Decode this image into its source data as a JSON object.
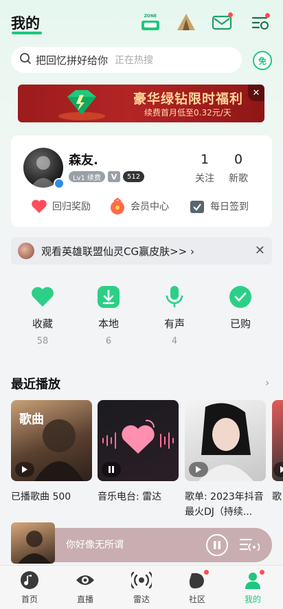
{
  "header": {
    "title": "我的",
    "zone_icon_text": "MUSIC ZONE",
    "icons": [
      "music-zone-icon",
      "tent-icon",
      "mail-icon",
      "menu-settings-icon"
    ]
  },
  "search": {
    "query": "把回忆拼好给你",
    "hint": "正在热搜",
    "free_label": "免"
  },
  "banner": {
    "title": "豪华绿钻限时福利",
    "subtitle": "续费首月低至0.32元/天"
  },
  "profile": {
    "username": "森友.",
    "level_badge": "Lv1 续费",
    "vip_badge": "V",
    "score_badge": "512",
    "follow_count": "1",
    "follow_label": "关注",
    "songs_count": "0",
    "songs_label": "新歌",
    "quick_links": {
      "reward": "回归奖励",
      "member": "会员中心",
      "checkin": "每日签到"
    }
  },
  "notice": {
    "text": "观看英雄联盟仙灵CG赢皮肤>> ›"
  },
  "library": {
    "favorites": {
      "label": "收藏",
      "count": "58"
    },
    "local": {
      "label": "本地",
      "count": "6"
    },
    "voice": {
      "label": "有声",
      "count": "4"
    },
    "purchased": {
      "label": "已购",
      "count": ""
    }
  },
  "recent": {
    "title": "最近播放",
    "more": "›",
    "cards": [
      {
        "tag": "歌曲",
        "label": "已播歌曲 500"
      },
      {
        "tag": "",
        "label": "音乐电台: 雷达"
      },
      {
        "tag": "",
        "label": "歌单: 2023年抖音最火DJ（持续..."
      },
      {
        "tag": "",
        "label": "歌"
      }
    ]
  },
  "player": {
    "title": "你好像无所谓"
  },
  "nav": {
    "home": "首页",
    "live": "直播",
    "radar": "雷达",
    "community": "社区",
    "mine": "我的"
  },
  "colors": {
    "accent": "#1ec77d",
    "badge_red": "#ff4d4f",
    "banner_red": "#b32525",
    "player_bg": "#c8aeb0"
  }
}
